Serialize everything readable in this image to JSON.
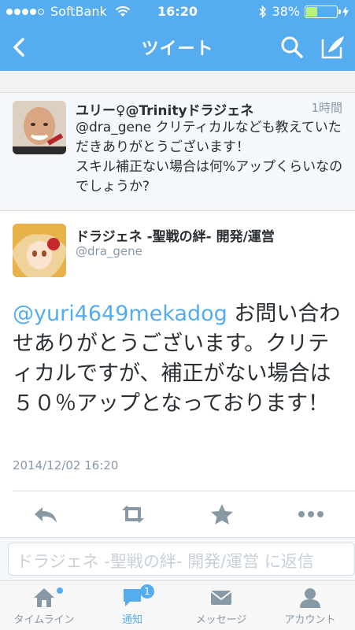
{
  "status_bar": {
    "carrier": "SoftBank",
    "time": "16:20",
    "battery_percent": "38%",
    "battery_level": 0.38
  },
  "nav": {
    "title": "ツイート"
  },
  "parent_tweet": {
    "name": "ユリー♀@Trinityドラジェネ",
    "time": "1時間",
    "text": "@dra_gene クリティカルなども教えていただきありがとうございます！\nスキル補正ない場合は何%アップくらいなのでしょうか?"
  },
  "main_tweet": {
    "name": "ドラジェネ -聖戦の絆- 開発/運営",
    "handle": "@dra_gene",
    "mention": "@yuri4649mekadog",
    "text": " お問い合わせありがとうございます。クリティカルですが、補正がない場合は５０％アップとなっております！",
    "date": "2014/12/02 16:20"
  },
  "reply": {
    "placeholder": "ドラジェネ -聖戦の絆- 開発/運営 に返信"
  },
  "tabs": [
    {
      "label": "タイムライン",
      "active": false
    },
    {
      "label": "通知",
      "active": true,
      "badge": "1"
    },
    {
      "label": "メッセージ",
      "active": false
    },
    {
      "label": "アカウント",
      "active": false
    }
  ],
  "colors": {
    "brand": "#55acee",
    "text": "#292f33",
    "muted": "#8899a6"
  },
  "icons": {
    "nav": [
      "back-chevron-icon",
      "search-icon",
      "compose-icon"
    ],
    "actions": [
      "reply-icon",
      "retweet-icon",
      "favorite-star-icon",
      "more-icon"
    ],
    "tabs": [
      "home-icon",
      "notifications-icon",
      "messages-icon",
      "account-icon"
    ]
  }
}
